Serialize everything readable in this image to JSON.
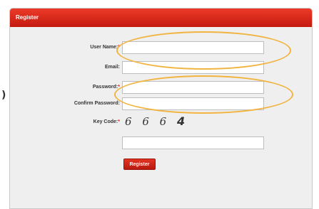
{
  "page_edge_text": ")",
  "form": {
    "title": "Register",
    "username": {
      "label": "User Name:",
      "value": "",
      "placeholder": ""
    },
    "email": {
      "label": "Email:",
      "value": "",
      "placeholder": ""
    },
    "password": {
      "label": "Password:",
      "value": "",
      "placeholder": ""
    },
    "confirm_password": {
      "label": "Confirm Password:",
      "value": "",
      "placeholder": ""
    },
    "key_code": {
      "label": "Key Code:",
      "captcha_digits": [
        "6",
        "6",
        "6",
        "4"
      ],
      "value": "",
      "placeholder": ""
    },
    "required_marker": "*",
    "submit_label": "Register"
  },
  "colors": {
    "header_red": "#d9261a",
    "required_red": "#e02010",
    "panel_bg": "#efefef",
    "highlight_orange": "#f2b440"
  }
}
